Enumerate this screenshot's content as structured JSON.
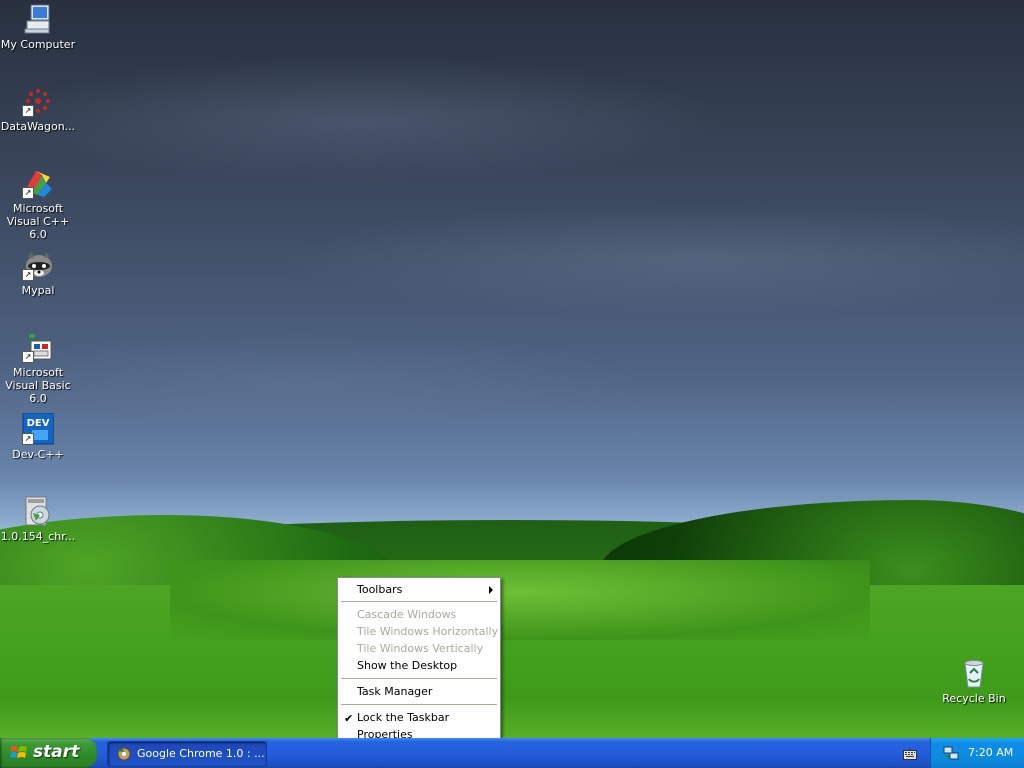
{
  "desktop": {
    "icons": [
      {
        "label": "My Computer"
      },
      {
        "label": "DataWagon..."
      },
      {
        "label": "Microsoft Visual C++ 6.0"
      },
      {
        "label": "Mypal"
      },
      {
        "label": "Microsoft Visual Basic 6.0"
      },
      {
        "label": "Dev-C++"
      },
      {
        "label": "1.0.154_chr..."
      },
      {
        "label": "Recycle Bin"
      }
    ],
    "dev_icon_text": "DEV"
  },
  "context_menu": {
    "items": [
      {
        "label": "Toolbars",
        "enabled": true,
        "has_submenu": true
      },
      {
        "label": "Cascade Windows",
        "enabled": false
      },
      {
        "label": "Tile Windows Horizontally",
        "enabled": false
      },
      {
        "label": "Tile Windows Vertically",
        "enabled": false
      },
      {
        "label": "Show the Desktop",
        "enabled": true
      },
      {
        "label": "Task Manager",
        "enabled": true
      },
      {
        "label": "Lock the Taskbar",
        "enabled": true,
        "checked": true
      },
      {
        "label": "Properties",
        "enabled": true
      }
    ],
    "check_mark": "✔"
  },
  "taskbar": {
    "start_label": "start",
    "tasks": [
      {
        "label": "Google Chrome 1.0 : ..."
      }
    ],
    "clock": "7:20 AM"
  },
  "colors": {
    "taskbar_blue": "#245edb",
    "start_green": "#3c9a35",
    "tray_blue": "#0f8be8"
  }
}
